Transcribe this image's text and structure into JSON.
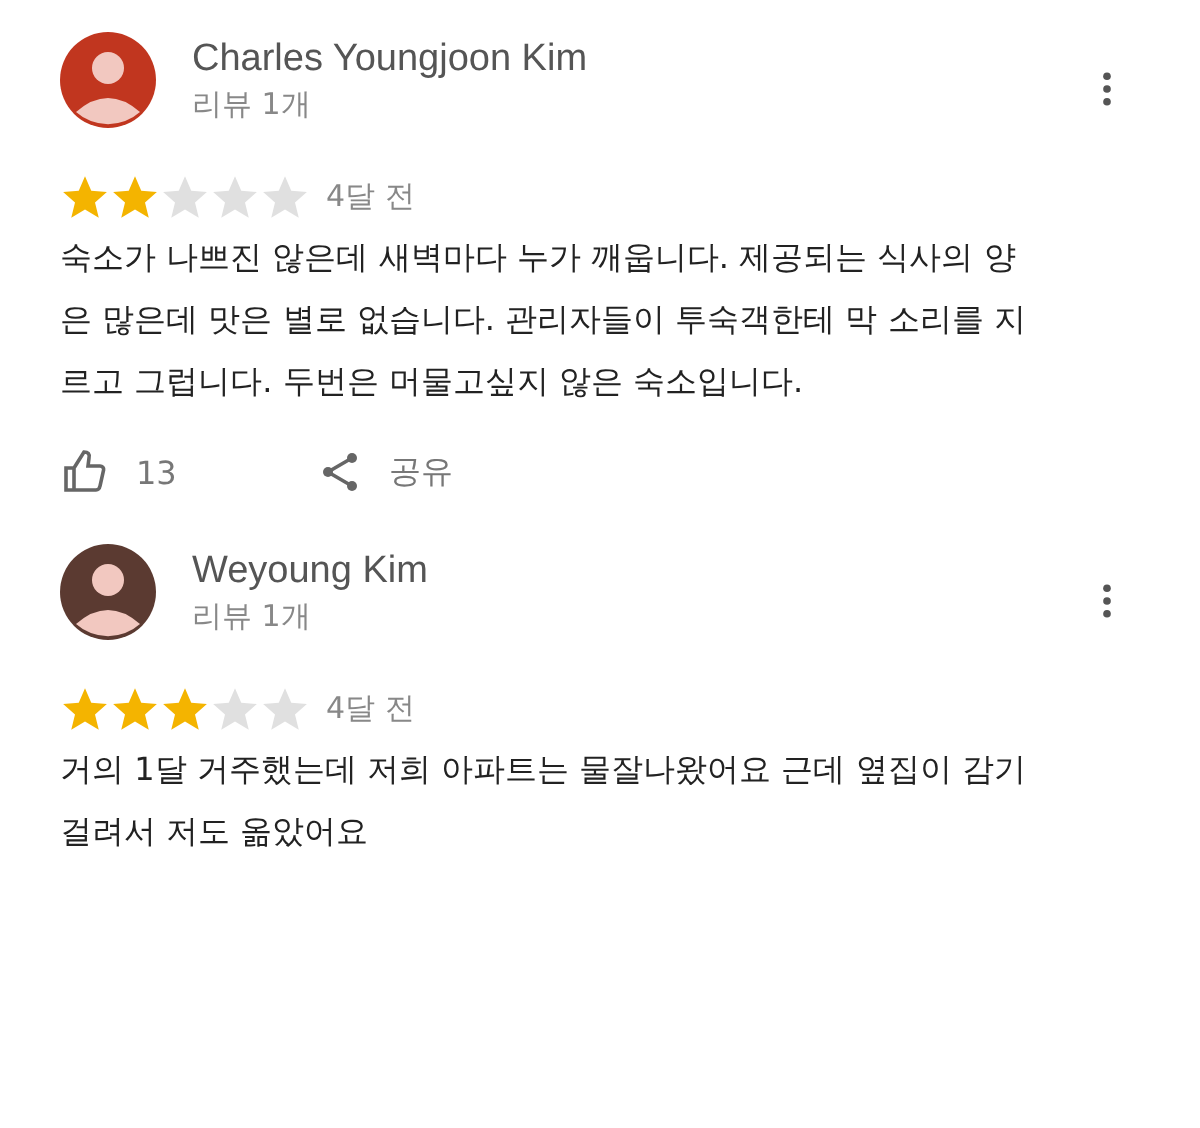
{
  "reviews": [
    {
      "author": "Charles Youngjoon Kim",
      "color": "#c1361f",
      "review_count": "리뷰 1개",
      "stars": 2,
      "time": "4달 전",
      "text": "숙소가 나쁘진 않은데 새벽마다 누가 깨웁니다. 제공되는 식사의 양은 많은데 맛은 별로 없습니다. 관리자들이 투숙객한테 막 소리를 지르고 그럽니다. 두번은 머물고싶지 않은 숙소입니다.",
      "likes": "13",
      "share": "공유"
    },
    {
      "author": "Weyoung Kim",
      "color": "#5b3a31",
      "review_count": "리뷰 1개",
      "stars": 3,
      "time": "4달 전",
      "text": "거의 1달 거주했는데 저희 아파트는 물잘나왔어요 근데 옆집이 감기걸려서 저도 옮았어요"
    }
  ]
}
